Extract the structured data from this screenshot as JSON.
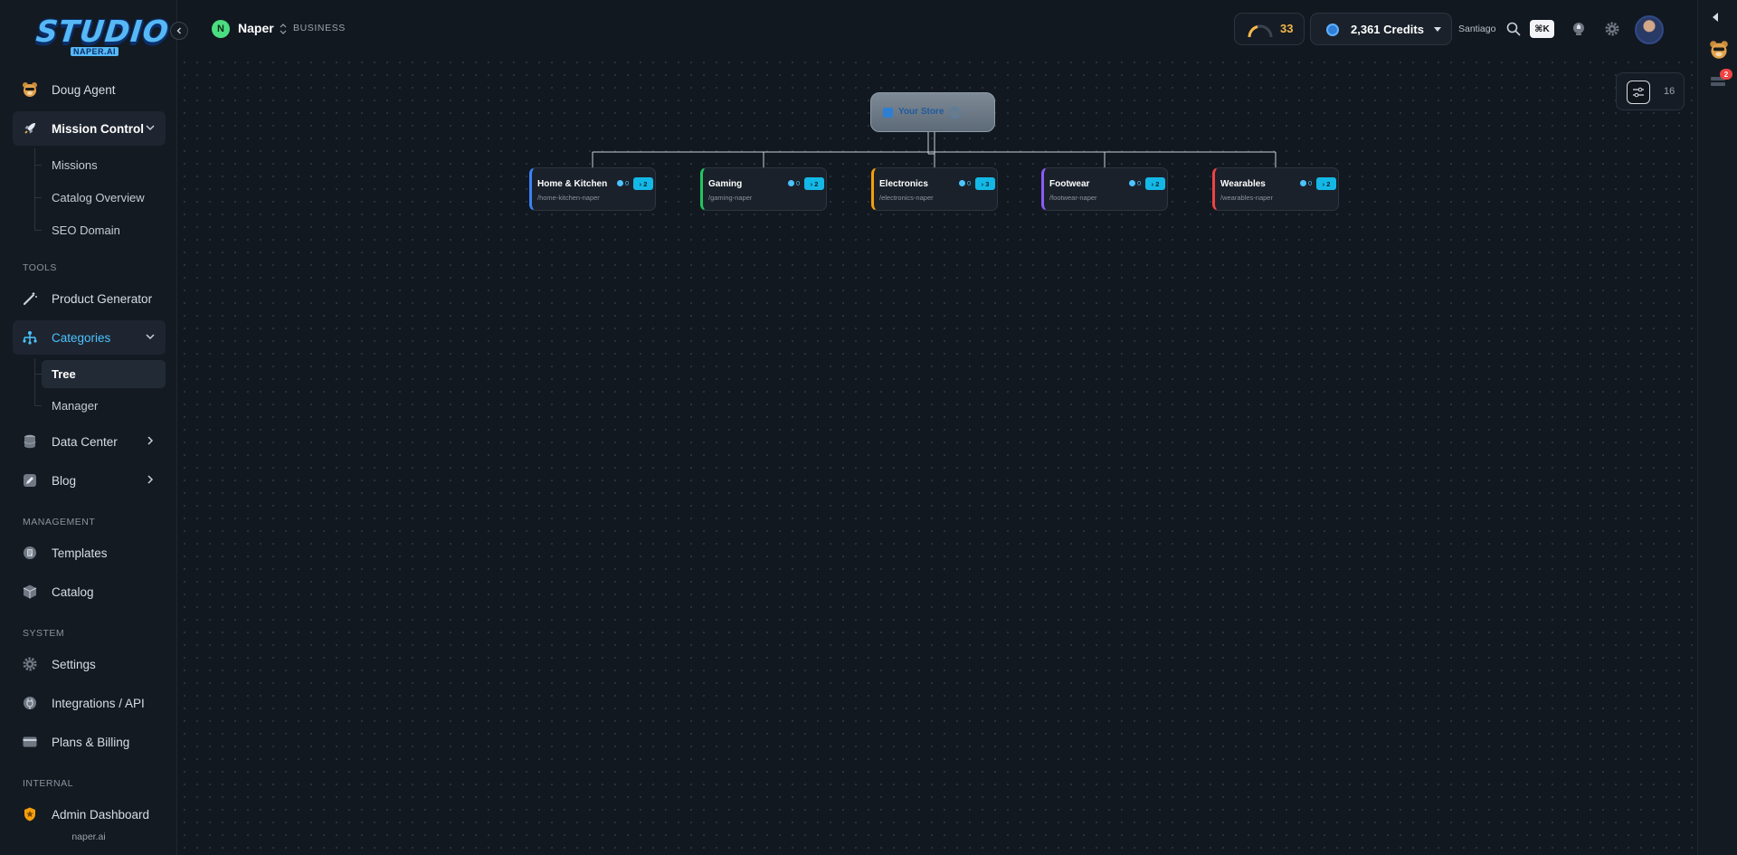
{
  "app": {
    "logo_text": "STUDIO",
    "logo_sub": "NAPER.AI",
    "footer_domain": "naper.ai"
  },
  "sidebar": {
    "agent": "Doug Agent",
    "mission_control": {
      "label": "Mission Control",
      "children": [
        "Missions",
        "Catalog Overview",
        "SEO Domain"
      ]
    },
    "sections": {
      "tools": "TOOLS",
      "management": "MANAGEMENT",
      "system": "SYSTEM",
      "internal": "INTERNAL"
    },
    "tools": {
      "product_generator": "Product Generator",
      "categories": {
        "label": "Categories",
        "children": [
          "Tree",
          "Manager"
        ]
      },
      "data_center": "Data Center",
      "blog": "Blog"
    },
    "management": {
      "templates": "Templates",
      "catalog": "Catalog"
    },
    "system": {
      "settings": "Settings",
      "integrations": "Integrations / API",
      "billing": "Plans & Billing"
    },
    "internal": {
      "admin": "Admin Dashboard"
    }
  },
  "header": {
    "workspace_initial": "N",
    "workspace_name": "Naper",
    "workspace_plan": "BUSINESS",
    "gauge_value": "33",
    "credits": "2,361 Credits",
    "user_name": "Santiago",
    "shortcut": "⌘K"
  },
  "right_rail": {
    "notification_count": "2"
  },
  "canvas": {
    "zoom_value": "16",
    "root": {
      "label": "Your Store",
      "count": "5"
    },
    "categories": [
      {
        "name": "Home & Kitchen",
        "slug": "/home-kitchen-naper",
        "products": "0",
        "subcategories": "2",
        "color": "#3b82f6"
      },
      {
        "name": "Gaming",
        "slug": "/gaming-naper",
        "products": "0",
        "subcategories": "2",
        "color": "#22c55e"
      },
      {
        "name": "Electronics",
        "slug": "/electronics-naper",
        "products": "0",
        "subcategories": "3",
        "color": "#f59e0b"
      },
      {
        "name": "Footwear",
        "slug": "/footwear-naper",
        "products": "0",
        "subcategories": "2",
        "color": "#8b5cf6"
      },
      {
        "name": "Wearables",
        "slug": "/wearables-naper",
        "products": "0",
        "subcategories": "2",
        "color": "#ef4444"
      }
    ]
  },
  "colors": {
    "accent": "#4cc3ff",
    "background": "#121820",
    "gauge": "#f5b84c"
  }
}
